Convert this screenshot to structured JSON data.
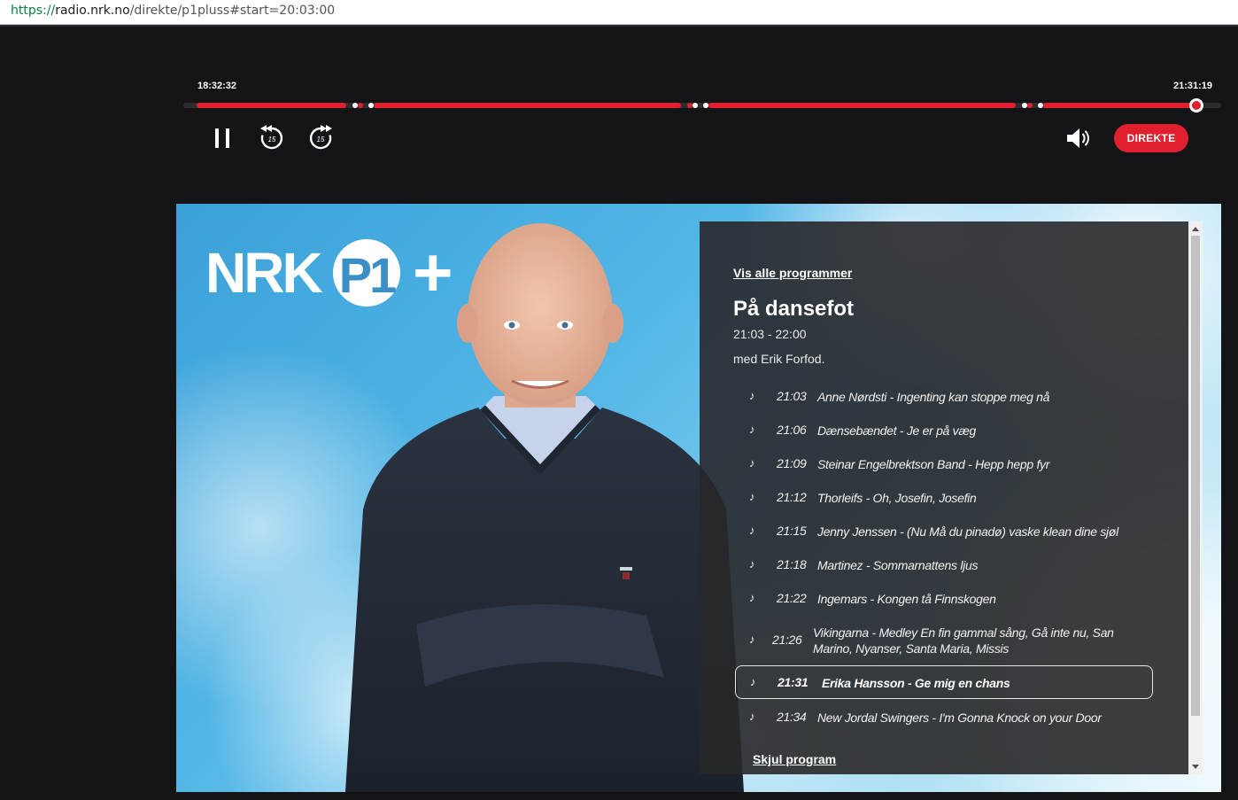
{
  "browser": {
    "url_scheme": "https://",
    "url_host": "radio.nrk.no",
    "url_path": "/direkte/p1pluss#start=20:03:00"
  },
  "player": {
    "start_time": "18:32:32",
    "end_time": "21:31:19",
    "live_label": "DIREKTE",
    "accent_color": "#e0202e",
    "icons": [
      "pause-icon",
      "rewind-15-icon",
      "forward-15-icon",
      "volume-icon"
    ],
    "skip_seconds": "15"
  },
  "logo": {
    "brand": "NRK",
    "channel": "P1",
    "plus": "+"
  },
  "program": {
    "all_programs_link": "Vis alle programmer",
    "title": "På dansefot",
    "time": "21:03 - 22:00",
    "host": "med Erik Forfod.",
    "hide_link": "Skjul program",
    "tracks": [
      {
        "time": "21:03",
        "title": "Anne Nørdsti - Ingenting kan stoppe meg nå"
      },
      {
        "time": "21:06",
        "title": "Dænsebændet - Je er på væg"
      },
      {
        "time": "21:09",
        "title": "Steinar Engelbrektson Band - Hepp hepp fyr"
      },
      {
        "time": "21:12",
        "title": "Thorleifs - Oh, Josefin, Josefin"
      },
      {
        "time": "21:15",
        "title": "Jenny Jenssen - (Nu Må du pinadø) vaske klean dine sjøl"
      },
      {
        "time": "21:18",
        "title": "Martinez - Sommarnattens ljus"
      },
      {
        "time": "21:22",
        "title": "Ingemars - Kongen tå Finnskogen"
      },
      {
        "time": "21:26",
        "title": "Vikingarna - Medley En fin gammal sång, Gå inte nu, San Marino, Nyanser, Santa Maria, Missis"
      },
      {
        "time": "21:31",
        "title": "Erika Hansson - Ge mig en chans"
      },
      {
        "time": "21:34",
        "title": "New Jordal Swingers - I'm Gonna Knock on your Door"
      }
    ]
  }
}
